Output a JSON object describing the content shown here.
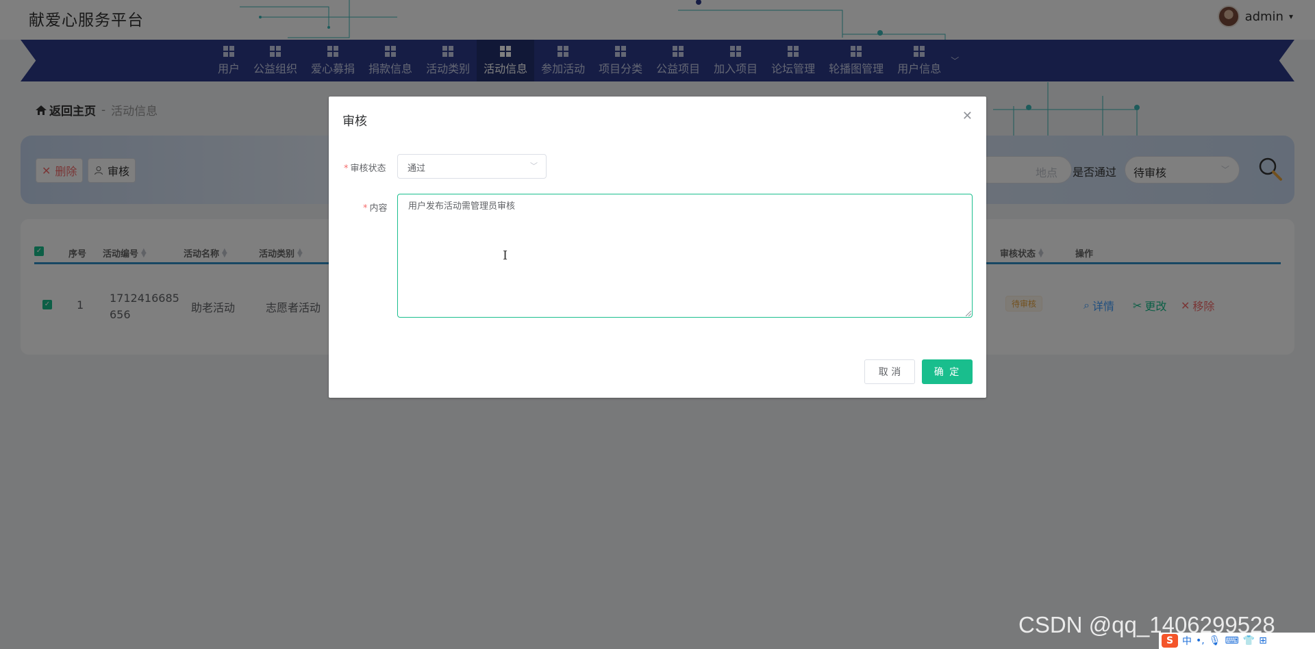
{
  "app": {
    "title": "献爱心服务平台",
    "user": "admin",
    "user_caret": "▾"
  },
  "nav": {
    "items": [
      {
        "label": "用户",
        "active": false
      },
      {
        "label": "公益组织",
        "active": false
      },
      {
        "label": "爱心募捐",
        "active": false
      },
      {
        "label": "捐款信息",
        "active": false
      },
      {
        "label": "活动类别",
        "active": false
      },
      {
        "label": "活动信息",
        "active": true
      },
      {
        "label": "参加活动",
        "active": false
      },
      {
        "label": "项目分类",
        "active": false
      },
      {
        "label": "公益项目",
        "active": false
      },
      {
        "label": "加入项目",
        "active": false
      },
      {
        "label": "论坛管理",
        "active": false
      },
      {
        "label": "轮播图管理",
        "active": false
      },
      {
        "label": "用户信息",
        "active": false
      }
    ]
  },
  "breadcrumb": {
    "home": "返回主页",
    "separator": "-",
    "current": "活动信息"
  },
  "search": {
    "delete_label": "删除",
    "audit_label": "审核",
    "input_placeholder": "地点",
    "pass_label": "是否通过",
    "pass_value": "待审核"
  },
  "table": {
    "headers": [
      "序号",
      "活动编号",
      "活动名称",
      "活动类别",
      "审核状态",
      "操作"
    ],
    "row": {
      "index": "1",
      "code": "1712416685656",
      "code_line1": "1712416685",
      "code_line2": "656",
      "name": "助老活动",
      "category": "志愿者活动",
      "status": "待审核",
      "actions": {
        "detail": "详情",
        "edit": "更改",
        "remove": "移除"
      }
    }
  },
  "dialog": {
    "title": "审核",
    "status_label": "审核状态",
    "status_value": "通过",
    "content_label": "内容",
    "content_value": "用户发布活动需管理员审核",
    "cancel_label": "取 消",
    "ok_label": "确 定"
  },
  "watermark": "CSDN @qq_1406299528",
  "tray": {
    "logo": "S",
    "ime": "中"
  },
  "colors": {
    "accent": "#19be8d",
    "nav_bg": "#2c3a8a",
    "nav_active": "#23306f",
    "danger": "#f56c6c",
    "warning": "#e6a23c",
    "link": "#409eff"
  }
}
